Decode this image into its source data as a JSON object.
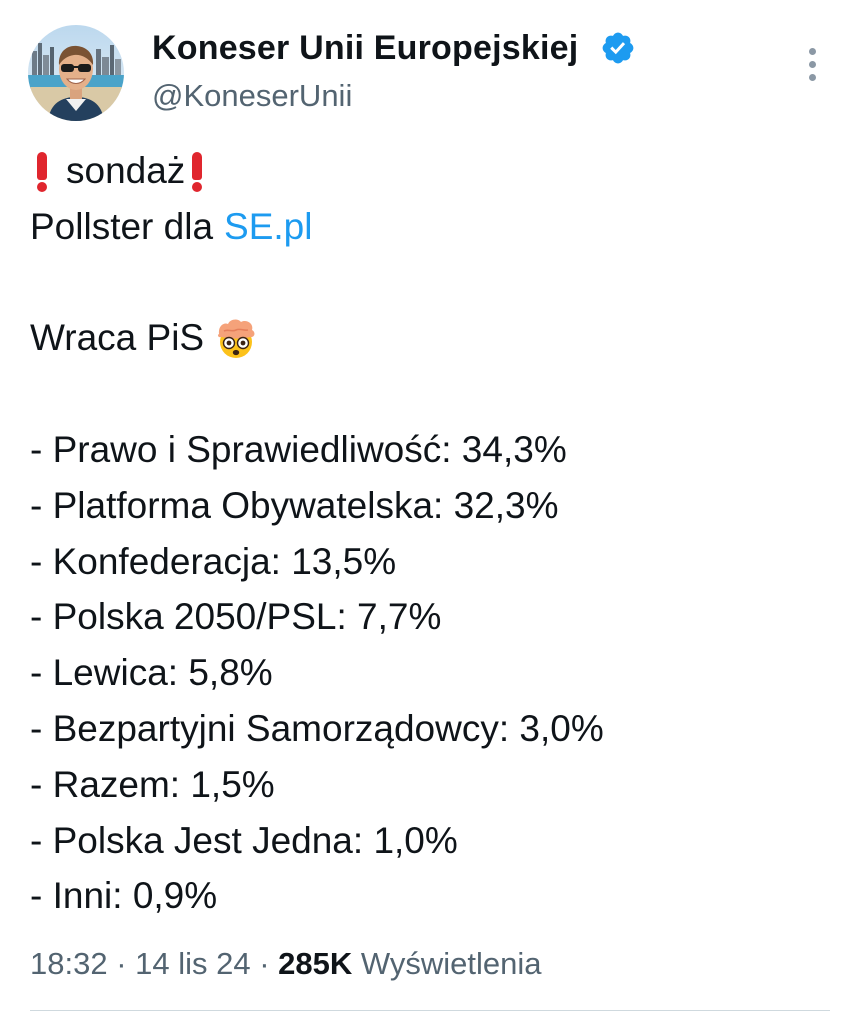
{
  "author": {
    "display_name": "Koneser Unii Europejskiej",
    "handle": "@KoneserUnii",
    "verified": true,
    "verified_color": "#1d9bf0"
  },
  "icons": {
    "avatar": "avatar-photo",
    "verified": "verified-badge-icon",
    "more": "more-options-icon",
    "exclamation": "red-exclamation-emoji",
    "face": "exploding-head-emoji"
  },
  "tweet": {
    "headline": "sondaż",
    "source_prefix": "Pollster dla",
    "source_link": "SE.pl",
    "subhead": "Wraca PiS",
    "results": [
      "- Prawo i Sprawiedliwość: 34,3%",
      "- Platforma Obywatelska: 32,3%",
      "- Konfederacja: 13,5%",
      "- Polska 2050/PSL: 7,7%",
      "- Lewica: 5,8%",
      "- Bezpartyjni Samorządowcy: 3,0%",
      "- Razem: 1,5%",
      "- Polska Jest Jedna: 1,0%",
      "- Inni: 0,9%"
    ]
  },
  "meta": {
    "time": "18:32",
    "separator": " · ",
    "date": "14 lis 24",
    "views_count": "285K",
    "views_label": "Wyświetlenia"
  },
  "colors": {
    "text": "#0f1419",
    "secondary": "#536471",
    "link": "#1d9bf0",
    "exclamation": "#e0262e"
  }
}
